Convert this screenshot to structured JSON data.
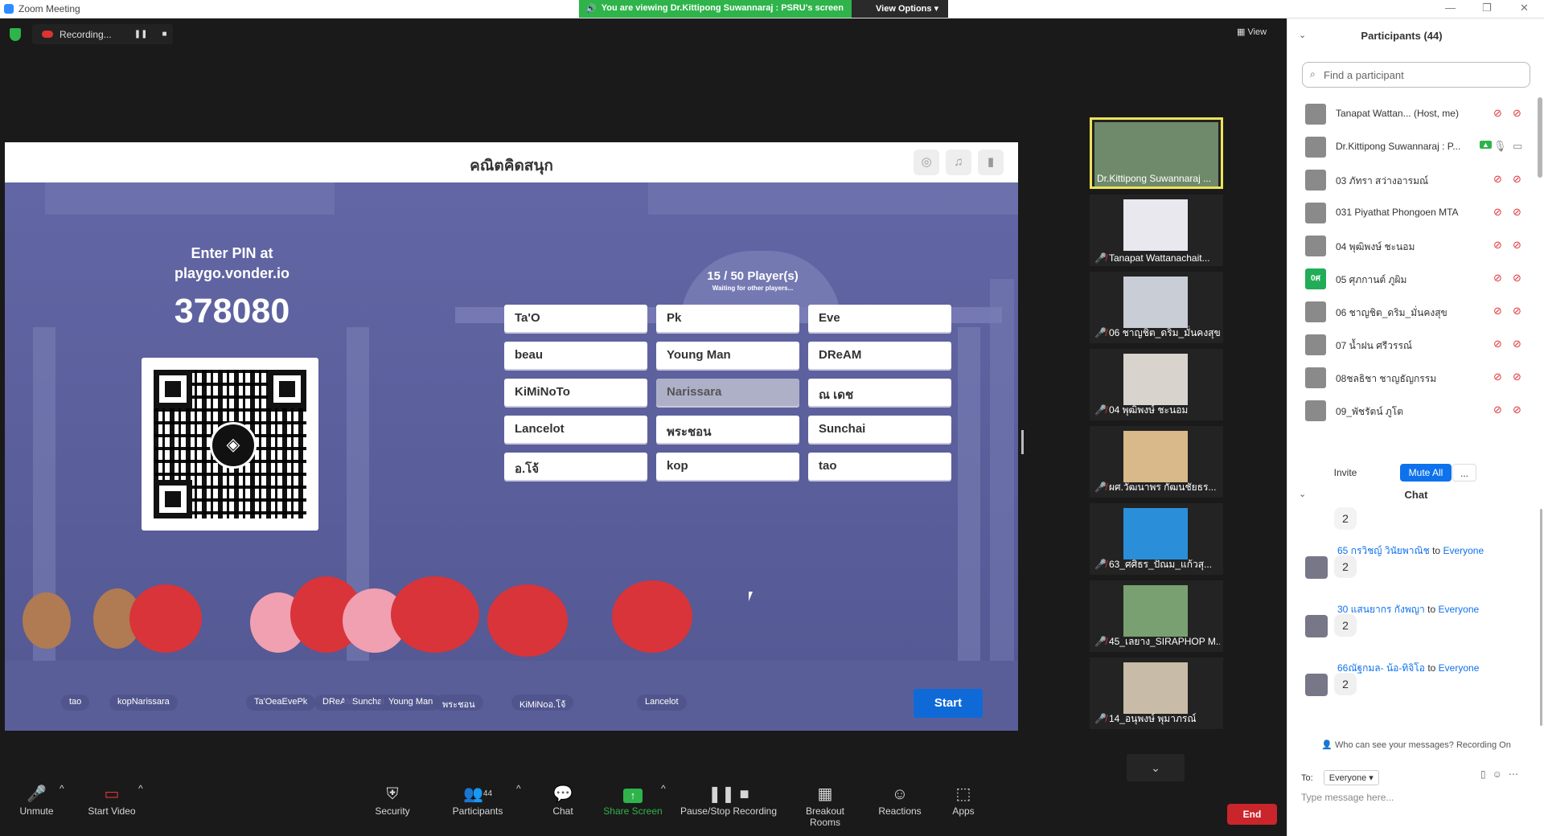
{
  "window": {
    "title": "Zoom Meeting"
  },
  "share_banner": {
    "message": "You are viewing Dr.Kittipong Suwannaraj : PSRU's screen",
    "view_options": "View Options"
  },
  "recording": {
    "label": "Recording..."
  },
  "view_button": "View",
  "game": {
    "title": "คณิตคิดสนุก",
    "enter_pin_line1": "Enter PIN at",
    "enter_pin_line2": "playgo.vonder.io",
    "pin": "378080",
    "player_count": "15 / 50 Player(s)",
    "waiting": "Waiting for other players...",
    "players": [
      [
        "Ta'O",
        "Pk",
        "Eve"
      ],
      [
        "beau",
        "Young Man",
        "DReAM"
      ],
      [
        "KiMiNoTo",
        "Narissara",
        "ณ เดช"
      ],
      [
        "Lancelot",
        "พระชอน",
        "Sunchai"
      ],
      [
        "อ.โจ้",
        "kop",
        "tao"
      ]
    ],
    "ground_labels": [
      "tao",
      "kopNarissara",
      "Ta'OeaEvePk",
      "DReAM",
      "Sunchai",
      "Young Man",
      "พระชอน",
      "KiMiNoอ.โจ้",
      "Lancelot"
    ],
    "start": "Start"
  },
  "thumbnails": [
    {
      "name": "Dr.Kittipong Suwannaraj ...",
      "muted": false,
      "active": true
    },
    {
      "name": "Tanapat Wattanachait...",
      "muted": true
    },
    {
      "name": "06 ชาญชิต_ดริม_มั่นคงสุข",
      "muted": true
    },
    {
      "name": "04 พุฒิพงษ์ ชะนอม",
      "muted": true
    },
    {
      "name": "ผศ.วัฒนาพร กัฒนชัยธร...",
      "muted": true
    },
    {
      "name": "63_ศศิธร_ปัณม_แก้วสุ...",
      "muted": true
    },
    {
      "name": "45_เลยาง_SIRAPHOP M...",
      "muted": true
    },
    {
      "name": "14_อนุพงษ์ พุมาภรณ์",
      "muted": true
    }
  ],
  "toolbar": {
    "unmute": "Unmute",
    "start_video": "Start Video",
    "security": "Security",
    "participants": "Participants",
    "participants_count": "44",
    "chat": "Chat",
    "share_screen": "Share Screen",
    "pause_stop_recording": "Pause/Stop Recording",
    "breakout_rooms": "Breakout Rooms",
    "reactions": "Reactions",
    "apps": "Apps",
    "end": "End"
  },
  "participants_panel": {
    "title": "Participants (44)",
    "search_placeholder": "Find a participant",
    "list": [
      {
        "name": "Tanapat Wattan...  (Host, me)"
      },
      {
        "name": "Dr.Kittipong Suwannaraj : P..."
      },
      {
        "name": "03 ภัทรา สว่างอารมณ์"
      },
      {
        "name": "031 Piyathat Phongoen MTA"
      },
      {
        "name": "04 พุฒิพงษ์ ชะนอม"
      },
      {
        "name": "05 ศุภกานต์ ภูผิม",
        "initials": "0ศ"
      },
      {
        "name": "06 ชาญชิต_ดริม_มั่นคงสุข"
      },
      {
        "name": "07 น้ำฝน ศรีวรรณ์"
      },
      {
        "name": "08ชลธิชา ชาญธัญกรรม"
      },
      {
        "name": "09_พัชรัตน์ ภูโต"
      }
    ],
    "invite": "Invite",
    "mute_all": "Mute All",
    "more": "..."
  },
  "chat_panel": {
    "title": "Chat",
    "messages": [
      {
        "from": "65 กรวิชญ์ วินัยพาณิช",
        "to": "Everyone",
        "text": "2"
      },
      {
        "from": "30 แสนยากร กังพญา",
        "to": "Everyone",
        "text": "2"
      },
      {
        "from": "66ณัฐกมล- น้อ-ทิจิโอ",
        "to": "Everyone",
        "text": "2"
      }
    ],
    "top_partial": "2",
    "to_word": "to",
    "who_can_see": "Who can see your messages? Recording On",
    "to_label": "To:",
    "to_value": "Everyone",
    "placeholder": "Type message here..."
  },
  "colors": {
    "zoom_blue": "#0e72ed",
    "share_green": "#2eb44a",
    "end_red": "#c9252b",
    "active_speaker": "#ede25a"
  }
}
